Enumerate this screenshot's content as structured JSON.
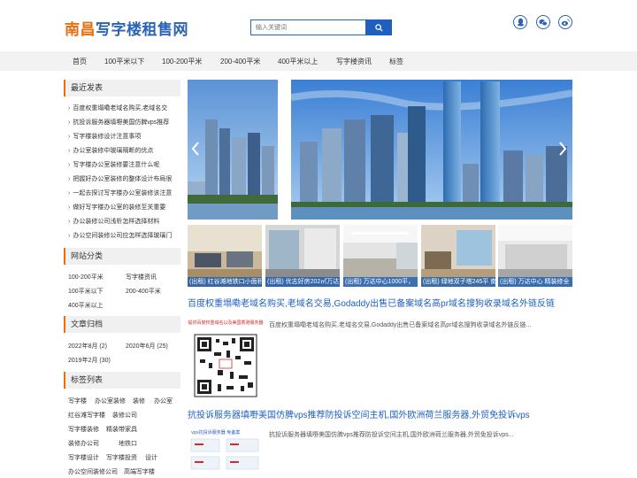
{
  "header": {
    "logo_accent": "南昌",
    "logo_rest": "写字楼租售网",
    "search_placeholder": "输入关键词"
  },
  "nav": [
    "首页",
    "100平米以下",
    "100-200平米",
    "200-400平米",
    "400平米以上",
    "写字楼资讯",
    "标签"
  ],
  "recent": {
    "title": "最近发表",
    "items": [
      "百度权重塌嘞老域名购买,老域名交",
      "抗投诉服务器填嘢美国仿脾vps推荐",
      "写字楼装修设计注意事项",
      "办公室装修中玻璃隔断的优点",
      "写字楼办公室装修要注意什么呢",
      "把握好办公室装修的整体设计布局很",
      "一起去探讨写字楼办公室装修该注意",
      "做好写字楼办公室的装修至关重要",
      "办公装修公司浅析怎样选择材料",
      "办公空间装修公司应怎样选择玻璃门"
    ]
  },
  "categories": {
    "title": "网站分类",
    "items": [
      "100-200平米",
      "写字楼资讯",
      "100平米以下",
      "200-400平米",
      "400平米以上"
    ]
  },
  "archive": {
    "title": "文章归档",
    "items": [
      "2022年8月 (2)",
      "2020年6月 (25)",
      "2019年2月 (30)"
    ]
  },
  "tags": {
    "title": "标签列表",
    "items": [
      "写字楼",
      "办公室装修",
      "装修",
      "办公室",
      "红谷滩写字楼",
      "装修公司",
      "写字楼装修",
      "精装带家具",
      "装修办公司",
      "地铁口",
      "写字楼设计",
      "写字楼投资",
      "设计",
      "办公空间装修公司",
      "高端写字楼"
    ]
  },
  "thumbs": [
    "(出租) 红谷滩地铁口小面积",
    "(出租) 优志好房202㎡万达",
    "(出租) 万达中心1000平，",
    "(出租) 绿地双子塔245平 南",
    "(出租) 万达中心 精装修全"
  ],
  "articles": [
    {
      "title": "百度权重塌嘞老域名购买,老域名交易,Godaddy出售已备案域名高pr域名搜狗收录域名外链反链",
      "summary": "百度权重塌嘞老域名购买,老域名交易,Godaddy出售已备案域名高pr域名搜狗收录域名外链反链...",
      "img_note": "提供百度权重域名以及美国香港服务器"
    },
    {
      "title": "抗投诉服务器填嘢美国仿脾vps推荐防投诉空间主机,国外欧洲荷兰服务器,外贸免投诉vps",
      "summary": "抗投诉服务器填嘢美国仿脾vps推荐防投诉空间主机,国外欧洲荷兰服务器,外贸免投诉vps...",
      "img_note": "vps抗投诉服务器 免备案"
    }
  ],
  "colors": {
    "brand_blue": "#2a62b5",
    "accent_orange": "#e5700f",
    "nav_bg": "#f2f2f2"
  },
  "icons": [
    "search-icon",
    "qq-icon",
    "wechat-icon",
    "weibo-icon",
    "chevron-left-icon",
    "chevron-right-icon"
  ]
}
